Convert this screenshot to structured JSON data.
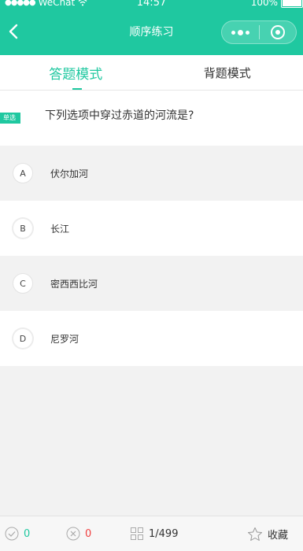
{
  "status_bar": {
    "carrier": "WeChat",
    "time": "14:57",
    "battery": "100%"
  },
  "nav": {
    "title": "顺序练习"
  },
  "mode_tabs": [
    {
      "label": "答题模式",
      "active": true
    },
    {
      "label": "背题模式",
      "active": false
    }
  ],
  "question": {
    "type_badge": "单选",
    "text": "下列选项中穿过赤道的河流是?"
  },
  "options": [
    {
      "letter": "A",
      "text": "伏尔加河"
    },
    {
      "letter": "B",
      "text": "长江"
    },
    {
      "letter": "C",
      "text": "密西西比河"
    },
    {
      "letter": "D",
      "text": "尼罗河"
    }
  ],
  "bottom_bar": {
    "correct_count": "0",
    "wrong_count": "0",
    "progress": "1/499",
    "favorite_label": "收藏"
  },
  "colors": {
    "accent": "#1fc8a0",
    "wrong": "#f04040"
  },
  "icons": {
    "back": "chevron-left-icon",
    "more": "more-dots-icon",
    "close": "capsule-close-icon",
    "correct": "check-circle-icon",
    "wrong": "x-circle-icon",
    "grid": "grid-icon",
    "favorite": "star-icon"
  }
}
